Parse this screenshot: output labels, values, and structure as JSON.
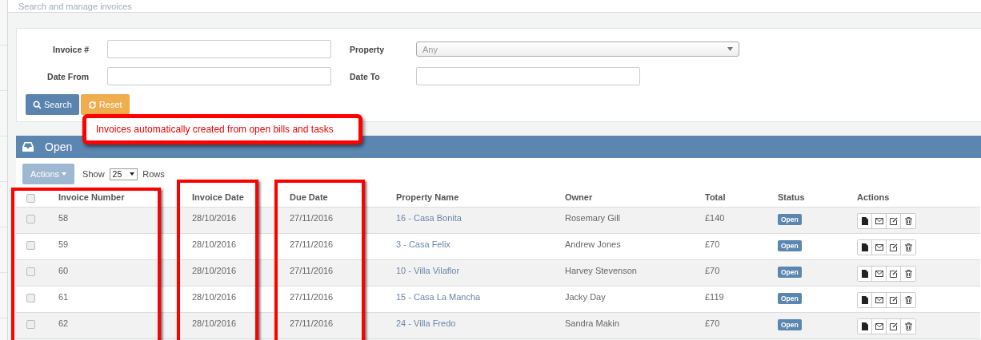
{
  "page": {
    "subtitle": "Search and manage invoices"
  },
  "search": {
    "fields": [
      {
        "kind": "text",
        "label": "Invoice #"
      },
      {
        "kind": "select",
        "label": "Property",
        "value": "Any"
      },
      {
        "kind": "text",
        "label": "Date From"
      },
      {
        "kind": "date",
        "label": "Date To"
      }
    ],
    "buttons": [
      {
        "kind": "search",
        "label": "Search"
      },
      {
        "kind": "reset",
        "label": "Reset"
      }
    ]
  },
  "callout": "Invoices automatically created from open bills and tasks",
  "panel": {
    "title": "Open",
    "actions_button": "Actions",
    "show_label": "Show",
    "rows_value": "25",
    "rows_label": "Rows"
  },
  "table": {
    "select_all_checked": false,
    "columns": [
      {
        "label": "Invoice Number",
        "highlighted": true
      },
      {
        "label": "Invoice Date",
        "highlighted": true
      },
      {
        "label": "Due Date",
        "highlighted": true
      },
      {
        "label": "Property Name",
        "highlighted": false
      },
      {
        "label": "Owner",
        "highlighted": false
      },
      {
        "label": "Total",
        "highlighted": false
      },
      {
        "label": "Status",
        "highlighted": false
      },
      {
        "label": "Actions",
        "highlighted": false
      }
    ],
    "rows": [
      {
        "checked": false,
        "number": "58",
        "invoice_date": "28/10/2016",
        "due_date": "27/11/2016",
        "property": "16 - Casa Bonita",
        "owner": "Rosemary Gill",
        "total": "£140",
        "status": "Open"
      },
      {
        "checked": false,
        "number": "59",
        "invoice_date": "28/10/2016",
        "due_date": "27/11/2016",
        "property": "3 - Casa Felix",
        "owner": "Andrew Jones",
        "total": "£70",
        "status": "Open"
      },
      {
        "checked": false,
        "number": "60",
        "invoice_date": "28/10/2016",
        "due_date": "27/11/2016",
        "property": "10 - Villa Vilaflor",
        "owner": "Harvey Stevenson",
        "total": "£70",
        "status": "Open"
      },
      {
        "checked": false,
        "number": "61",
        "invoice_date": "28/10/2016",
        "due_date": "27/11/2016",
        "property": "15 - Casa La Mancha",
        "owner": "Jacky Day",
        "total": "£119",
        "status": "Open"
      },
      {
        "checked": false,
        "number": "62",
        "invoice_date": "28/10/2016",
        "due_date": "27/11/2016",
        "property": "24 - Villa Fredo",
        "owner": "Sandra Makin",
        "total": "£70",
        "status": "Open"
      }
    ]
  }
}
